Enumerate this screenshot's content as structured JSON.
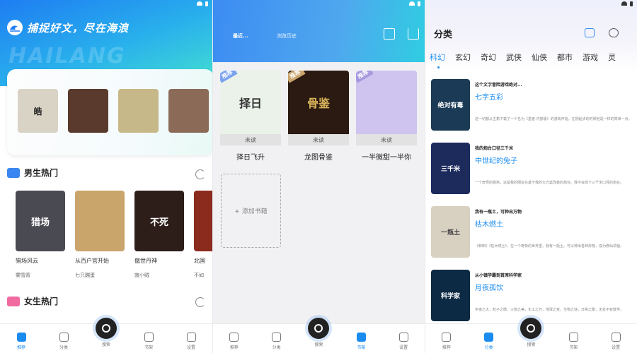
{
  "status": {
    "battery_icon": "battery-icon",
    "wifi_icon": "wifi-icon"
  },
  "panel1": {
    "slogan": "捕捉好文，尽在海浪",
    "watermark": "HAILANG",
    "hero_covers": [
      {
        "text": "皓",
        "color": "#d9d3c5"
      },
      {
        "text": "",
        "color": "#5a3a2c"
      },
      {
        "text": "",
        "color": "#c7b889"
      },
      {
        "text": "",
        "color": "#8b6b58"
      }
    ],
    "sections": {
      "male": {
        "title": "男生热门",
        "accent": "#3a86f0"
      },
      "female": {
        "title": "女生热门",
        "accent": "#f06aa0"
      }
    },
    "books": [
      {
        "name": "猎场风云",
        "author": "雾雪青",
        "color": "#4a4a52",
        "cover_text": "猎场"
      },
      {
        "name": "从百户官开始",
        "author": "七只蹦蛋",
        "color": "#c9a46b",
        "cover_text": ""
      },
      {
        "name": "傲世丹神",
        "author": "寂小贼",
        "color": "#2d1e1a",
        "cover_text": "不死"
      },
      {
        "name": "北国",
        "author": "不如",
        "color": "#8a2b1e",
        "cover_text": ""
      }
    ]
  },
  "panel2": {
    "tabs": {
      "recent": "最近...",
      "history": "浏览历史"
    },
    "shelf": [
      {
        "name": "择日飞升",
        "badge": "推荐",
        "unread": "未读",
        "color": "#eaf2ea",
        "cover_text": "择日"
      },
      {
        "name": "龙图骨鉴",
        "badge": "推荐",
        "unread": "未读",
        "color": "#2a1a12",
        "cover_text": "骨鉴"
      },
      {
        "name": "一半微甜一半你",
        "badge": "推荐",
        "unread": "未读",
        "color": "#cfc3ef",
        "cover_text": ""
      }
    ],
    "add_label": "+ 添加书籍"
  },
  "panel3": {
    "title": "分类",
    "categories": [
      "科幻",
      "玄幻",
      "奇幻",
      "武侠",
      "仙侠",
      "都市",
      "游戏",
      "灵"
    ],
    "active_category": "科幻",
    "feed": [
      {
        "title": "这个文字冒险游戏绝对...",
        "sub": "七字五彩",
        "desc": "这一切都从主角下载了一个名为《墨者·内部版》的游戏开始。在刚起步的时候他是一样的简单一点。",
        "color": "#1a3a55",
        "cover_text": "绝对有毒"
      },
      {
        "title": "我的炮台口径三千米",
        "sub": "中世纪的兔子",
        "desc": "一个奇怪的炮塔，这是我的朋友在基于我的大方案改装的炮台。我不会放下三千米口径的炮台。",
        "color": "#1c2a5c",
        "cover_text": "三千米"
      },
      {
        "title": "我有一瓶土，可种出万物",
        "sub": "枯木燃土",
        "desc": "《种田》《枯木燃土》，在一个奇特的世界里，我有一瓶土。可以种出各种异物，成为修仙领袖。",
        "color": "#d8d0c0",
        "cover_text": "一瓶土"
      },
      {
        "title": "从小镇学霸到首席科学家",
        "sub": "月夜孤饮",
        "desc": "宇宙之大，粒子之微，火箭之美，化工之巧，地球之变，生物之谜，日常之繁，无处不有数学。",
        "color": "#0d2a44",
        "cover_text": "科学家"
      }
    ]
  },
  "tabbar": {
    "p1": [
      {
        "label": "推荐",
        "icon": "home-icon",
        "active": true
      },
      {
        "label": "分类",
        "icon": "layers-icon",
        "active": false
      },
      {
        "label": "搜索",
        "icon": "search-icon",
        "active": false
      },
      {
        "label": "书架",
        "icon": "book-icon",
        "active": false
      },
      {
        "label": "设置",
        "icon": "gear-icon",
        "active": false
      }
    ],
    "p2": [
      {
        "label": "推荐",
        "icon": "home-icon",
        "active": false
      },
      {
        "label": "分类",
        "icon": "layers-icon",
        "active": false
      },
      {
        "label": "搜索",
        "icon": "search-icon",
        "active": false
      },
      {
        "label": "书架",
        "icon": "book-icon",
        "active": true
      },
      {
        "label": "设置",
        "icon": "gear-icon",
        "active": false
      }
    ],
    "p3": [
      {
        "label": "推荐",
        "icon": "home-icon",
        "active": false
      },
      {
        "label": "分类",
        "icon": "layers-icon",
        "active": true
      },
      {
        "label": "搜索",
        "icon": "search-icon",
        "active": false
      },
      {
        "label": "书架",
        "icon": "book-icon",
        "active": false
      },
      {
        "label": "设置",
        "icon": "gear-icon",
        "active": false
      }
    ]
  }
}
